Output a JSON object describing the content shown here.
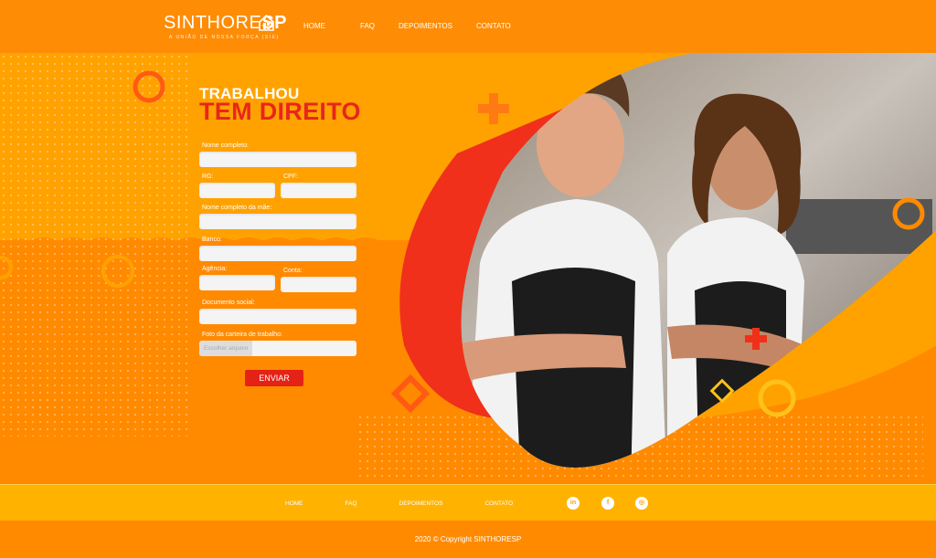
{
  "brand": {
    "name_light": "SINTHORE",
    "name_bold": "SP",
    "tagline": "A UNIÃO DE NOSSA FORÇA (SIE)"
  },
  "nav": {
    "home": "HOME",
    "faq": "FAQ",
    "testimonials": "DEPOIMENTOS",
    "contact": "CONTATO"
  },
  "hero": {
    "title_line1": "TRABALHOU",
    "title_line2": "TEM DIREITO"
  },
  "form": {
    "full_name_label": "Nome completo:",
    "rg_label": "RG:",
    "cpf_label": "CPF:",
    "mother_name_label": "Nome completo da mãe:",
    "bank_label": "Banco:",
    "agency_label": "Agência:",
    "account_label": "Conta:",
    "social_doc_label": "Documento social:",
    "work_card_label": "Foto da carteira de trabalho:",
    "file_button": "Escolher arquivo",
    "submit_label": "ENVIAR"
  },
  "footer": {
    "home": "HOME",
    "faq": "FAQ",
    "testimonials": "DEPOIMENTOS",
    "contact": "CONTATO",
    "linkedin_glyph": "in",
    "facebook_glyph": "f",
    "instagram_glyph": "◎",
    "copyright": "2020 © Copyright SINTHORESP"
  },
  "colors": {
    "orange": "#ff8a00",
    "light_orange": "#ffa200",
    "red": "#e52216",
    "footer_bar": "#ffb200"
  }
}
